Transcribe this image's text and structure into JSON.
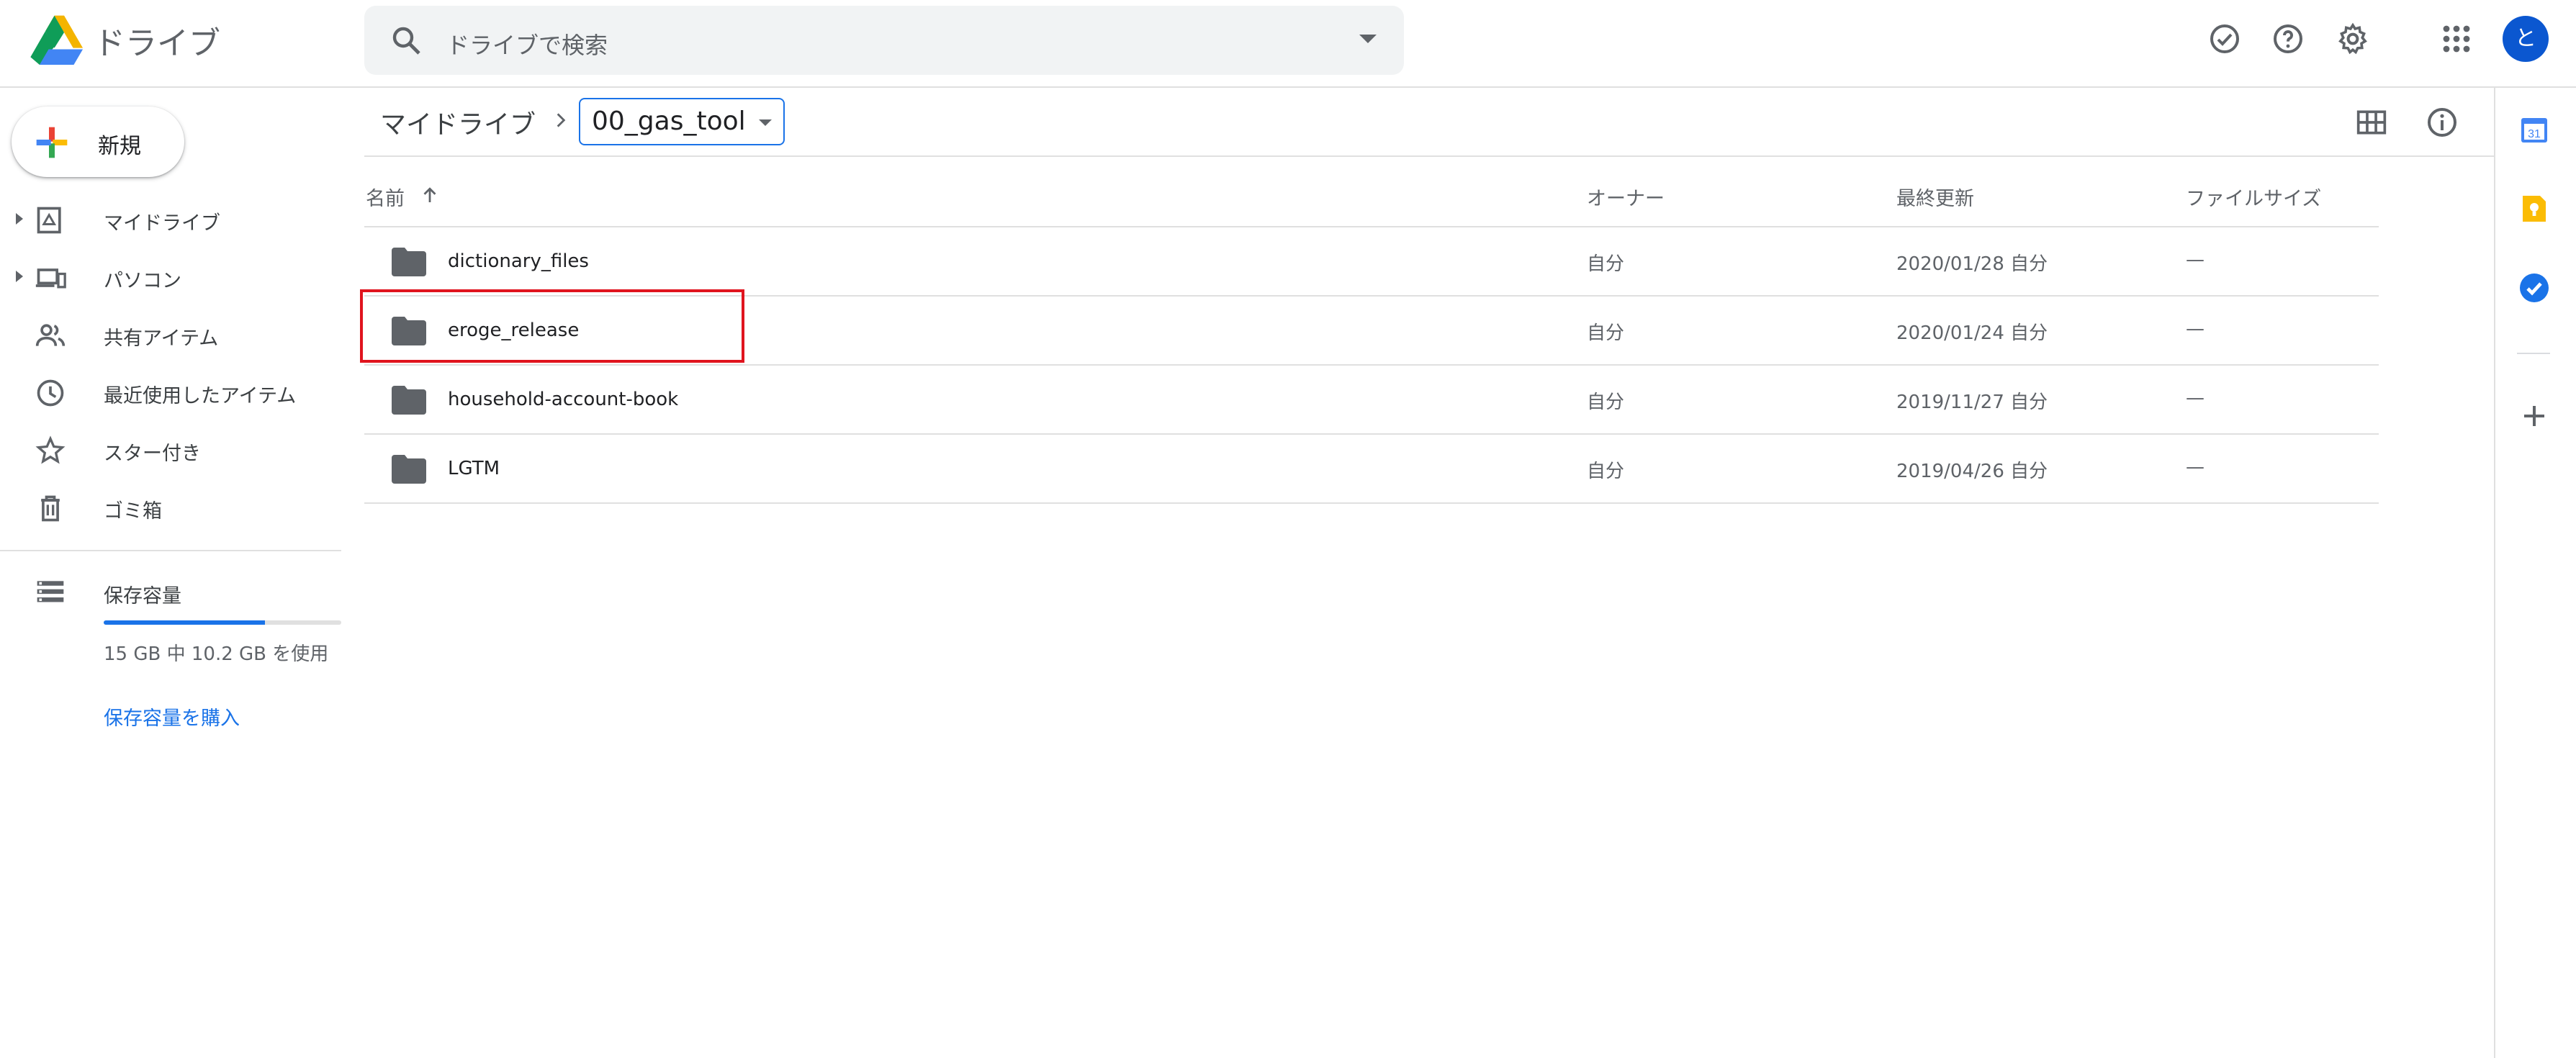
{
  "header": {
    "app_title": "ドライブ",
    "search_placeholder": "ドライブで検索",
    "avatar_letter": "と"
  },
  "new_button": {
    "label": "新規"
  },
  "sidebar": {
    "items": [
      {
        "label": "マイドライブ",
        "icon": "my-drive-icon",
        "expandable": true
      },
      {
        "label": "パソコン",
        "icon": "computers-icon",
        "expandable": true
      },
      {
        "label": "共有アイテム",
        "icon": "shared-people-icon",
        "expandable": false
      },
      {
        "label": "最近使用したアイテム",
        "icon": "clock-icon",
        "expandable": false
      },
      {
        "label": "スター付き",
        "icon": "star-icon",
        "expandable": false
      },
      {
        "label": "ゴミ箱",
        "icon": "trash-icon",
        "expandable": false
      }
    ],
    "storage": {
      "title": "保存容量",
      "usage_text": "15 GB 中 10.2 GB を使用",
      "used_fraction": 0.68,
      "buy_link": "保存容量を購入"
    }
  },
  "breadcrumb": {
    "root": "マイドライブ",
    "current": "00_gas_tool"
  },
  "table": {
    "columns": {
      "name": "名前",
      "owner": "オーナー",
      "modified": "最終更新",
      "size": "ファイルサイズ"
    },
    "rows": [
      {
        "name": "dictionary_files",
        "owner": "自分",
        "modified": "2020/01/28 自分",
        "size": "—"
      },
      {
        "name": "eroge_release",
        "owner": "自分",
        "modified": "2020/01/24 自分",
        "size": "—"
      },
      {
        "name": "household-account-book",
        "owner": "自分",
        "modified": "2019/11/27 自分",
        "size": "—"
      },
      {
        "name": "LGTM",
        "owner": "自分",
        "modified": "2019/04/26 自分",
        "size": "—"
      }
    ]
  },
  "side_panel": {
    "calendar_date": "31"
  },
  "colors": {
    "accent": "#1a73e8",
    "highlight": "#e0141e",
    "folder": "#5f6368",
    "keep": "#fbbc04"
  }
}
